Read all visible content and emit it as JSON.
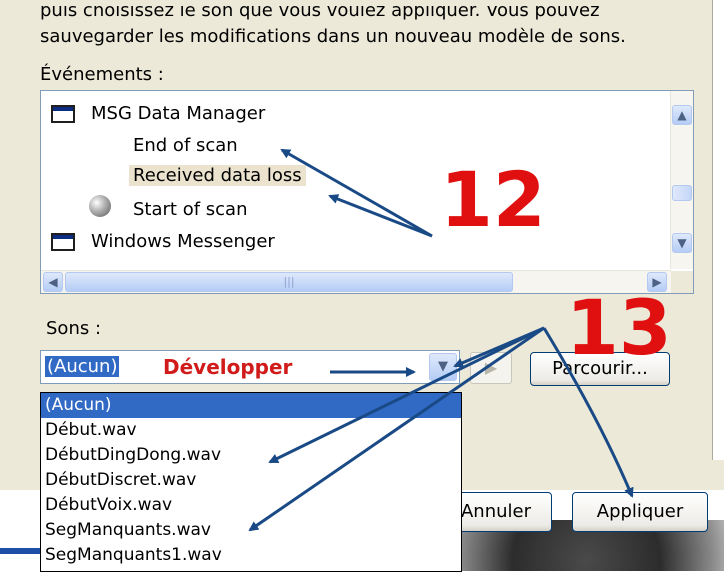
{
  "intro": {
    "line1": "puis choisissez le son que vous voulez appliquer. Vous pouvez",
    "line2": "sauvegarder les modifications dans un nouveau modèle de sons."
  },
  "events": {
    "label": "Événements :",
    "items": [
      {
        "label": "MSG Data Manager",
        "icon": "application-window-icon"
      },
      {
        "label": "End of scan",
        "icon": ""
      },
      {
        "label": "Received data loss",
        "icon": ""
      },
      {
        "label": "Start of scan",
        "icon": "speaker-icon"
      },
      {
        "label": "Windows Messenger",
        "icon": "application-window-icon"
      }
    ]
  },
  "sounds": {
    "label": "Sons :",
    "value": "(Aucun)",
    "options": [
      "(Aucun)",
      "Début.wav",
      "DébutDingDong.wav",
      "DébutDiscret.wav",
      "DébutVoix.wav",
      "SegManquants.wav",
      "SegManquants1.wav"
    ]
  },
  "buttons": {
    "browse": "Parcourir...",
    "cancel": "Annuler",
    "apply": "Appliquer"
  },
  "annotations": {
    "develop": "Développer",
    "num12": "12",
    "num13": "13"
  },
  "colors": {
    "annotation_red": "#e01010",
    "arrow_blue": "#1a4a86",
    "selection_blue": "#316ac5"
  }
}
